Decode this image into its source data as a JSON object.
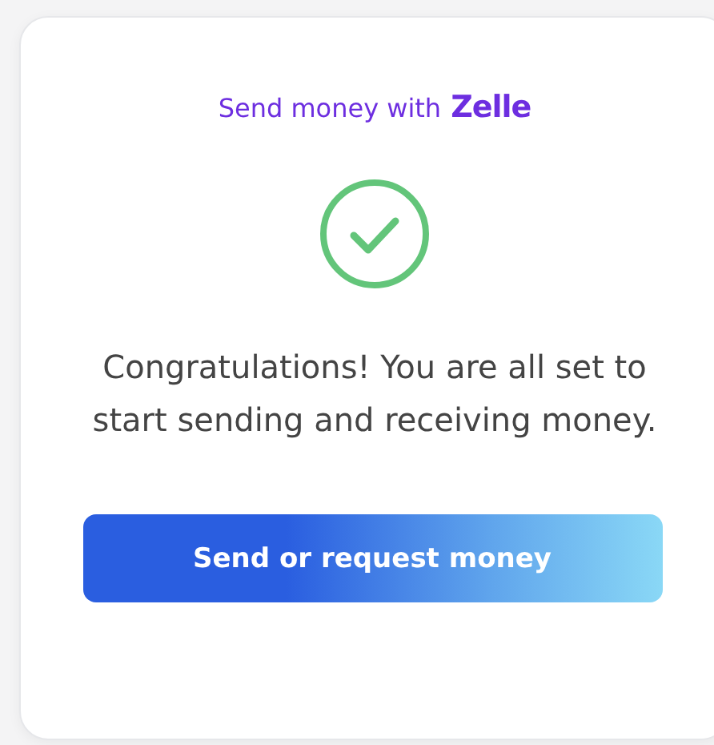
{
  "header": {
    "text": "Send money with",
    "brand": "Zelle"
  },
  "message": "Congratulations! You are all set to start sending and receiving money.",
  "button": {
    "label": "Send or request money"
  }
}
